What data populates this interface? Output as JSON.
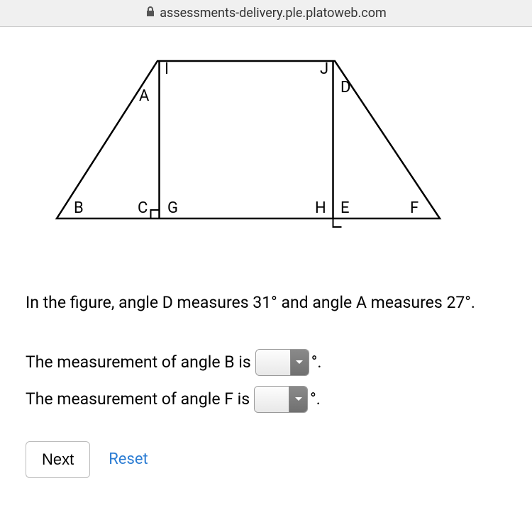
{
  "url": "assessments-delivery.ple.platoweb.com",
  "figure": {
    "labels": {
      "I": "I",
      "J": "J",
      "A": "A",
      "D": "D",
      "B": "B",
      "C": "C",
      "G": "G",
      "H": "H",
      "E": "E",
      "F": "F"
    }
  },
  "question_text": "In the figure, angle D measures 31° and angle A measures 27°.",
  "rows": [
    {
      "prefix": "The measurement of angle B is",
      "suffix": "°."
    },
    {
      "prefix": "The measurement of angle F is",
      "suffix": "°."
    }
  ],
  "buttons": {
    "next": "Next",
    "reset": "Reset"
  }
}
